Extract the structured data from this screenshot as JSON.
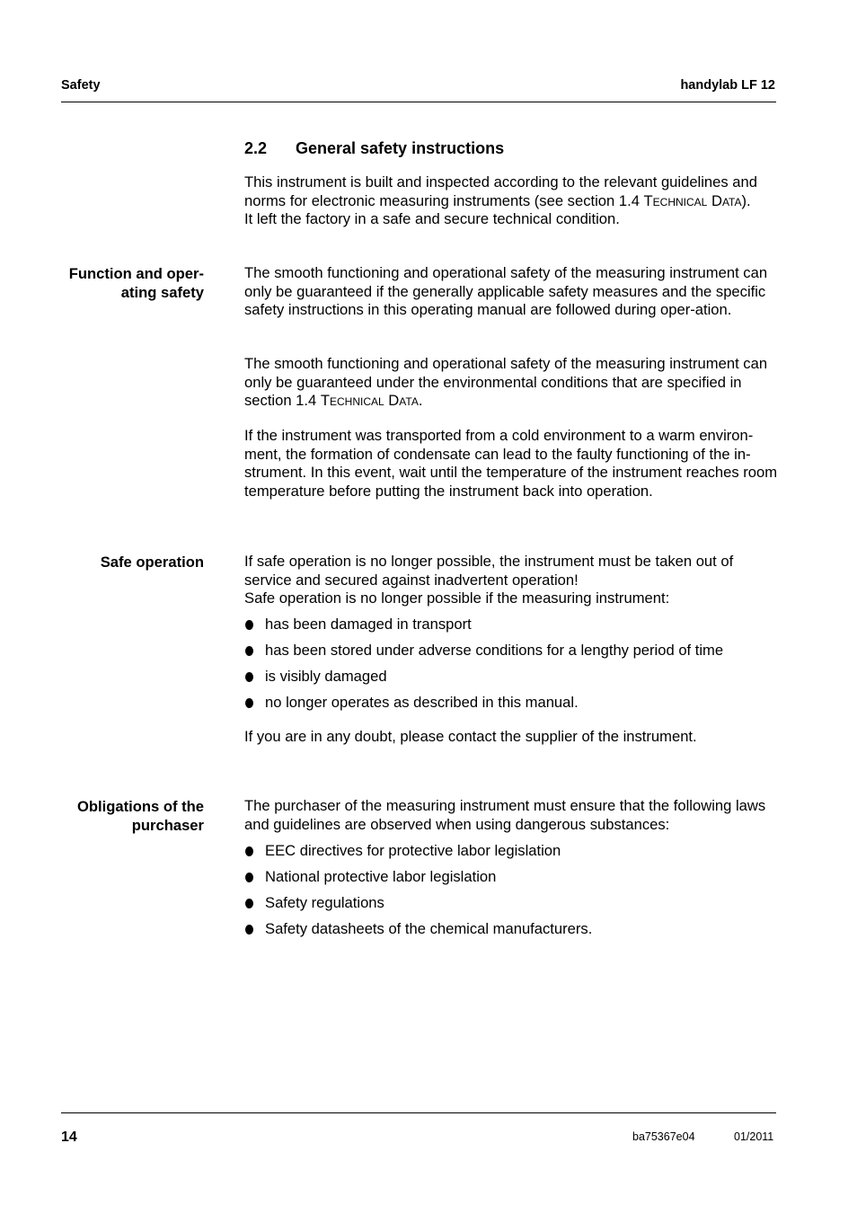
{
  "header": {
    "left": "Safety",
    "right": "handylab LF 12"
  },
  "section": {
    "number": "2.2",
    "title": "General safety instructions"
  },
  "intro": {
    "line1_pre": "This instrument is built and inspected according to the relevant guidelines and norms for electronic measuring instruments (see section 1.4 ",
    "line1_ref": "Technical Data",
    "line1_post": ").",
    "line2": "It left the factory in a safe and secure technical condition."
  },
  "function_safety": {
    "label": "Function and oper-ating safety",
    "label_line1": "Function and oper-",
    "label_line2": "ating safety",
    "para1": "The smooth functioning and operational safety of the measuring instrument can only be guaranteed if the generally applicable safety measures and the specific safety instructions in this operating manual are followed during oper-ation.",
    "para2_pre": "The smooth functioning and operational safety of the measuring instrument can only be guaranteed under the environmental conditions that are specified in section 1.4 ",
    "para2_ref": "Technical Data",
    "para2_post": ".",
    "para3": "If the instrument was transported from a cold environment to a warm environ-ment, the formation of condensate can lead to the faulty functioning of the in-strument. In this event, wait until the temperature of the instrument reaches room temperature before putting the instrument back into operation."
  },
  "safe_operation": {
    "label": "Safe operation",
    "para1": "If safe operation is no longer possible, the instrument must be taken out of service and secured against inadvertent operation!",
    "para2": "Safe operation is no longer possible if the measuring instrument:",
    "bullets": [
      "has been damaged in transport",
      "has been stored under adverse conditions for a lengthy period of time",
      "is visibly damaged",
      "no longer operates as described in this manual."
    ],
    "closing": "If you are in any doubt, please contact the supplier of the instrument."
  },
  "obligations": {
    "label_line1": "Obligations of the",
    "label_line2": "purchaser",
    "para1": "The purchaser of the measuring instrument must ensure that the following laws and guidelines are observed when using dangerous substances:",
    "bullets": [
      "EEC directives for protective labor legislation",
      "National protective labor legislation",
      "Safety regulations",
      "Safety datasheets of the chemical manufacturers."
    ]
  },
  "footer": {
    "page_number": "14",
    "doc_code": "ba75367e04",
    "date": "01/2011"
  }
}
